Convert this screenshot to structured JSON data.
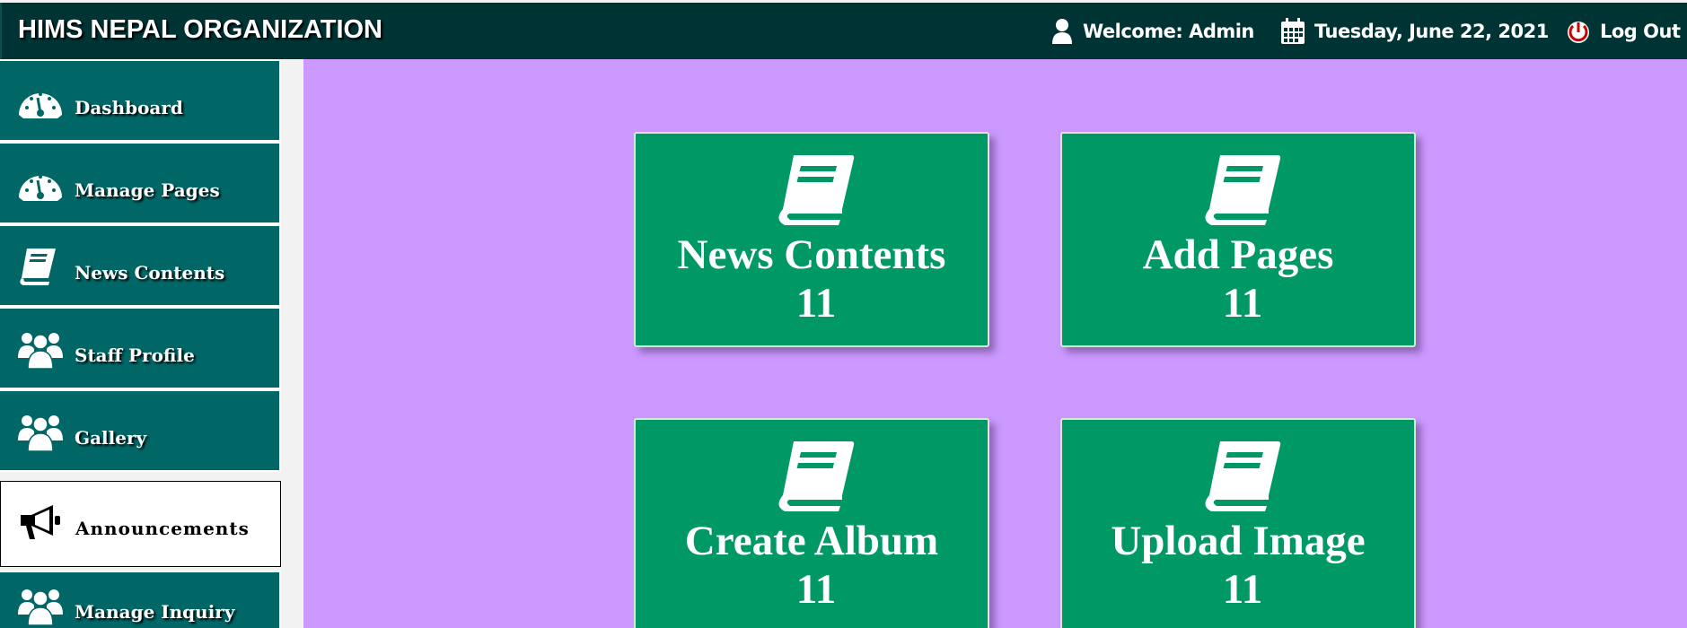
{
  "header": {
    "title": "HIMS NEPAL ORGANIZATION",
    "welcome": "Welcome: Admin",
    "date": "Tuesday, June 22, 2021",
    "logout": "Log Out"
  },
  "sidebar": {
    "items": [
      {
        "label": "Dashboard",
        "icon": "dashboard-icon"
      },
      {
        "label": "Manage Pages",
        "icon": "dashboard-icon"
      },
      {
        "label": "News Contents",
        "icon": "book-icon"
      },
      {
        "label": "Staff Profile",
        "icon": "users-icon"
      },
      {
        "label": "Gallery",
        "icon": "users-icon"
      },
      {
        "label": "Announcements",
        "icon": "megaphone-icon",
        "active": true
      },
      {
        "label": "Manage Inquiry",
        "icon": "users-icon"
      }
    ]
  },
  "cards": [
    {
      "title": "News Contents",
      "count": "11",
      "icon": "book-icon"
    },
    {
      "title": "Add Pages",
      "count": "11",
      "icon": "book-icon"
    },
    {
      "title": "Create Album",
      "count": "11",
      "icon": "book-icon"
    },
    {
      "title": "Upload Image",
      "count": "11",
      "icon": "book-icon"
    }
  ],
  "colors": {
    "header_bg": "#003333",
    "sidebar_bg": "#006666",
    "content_bg": "#cc99ff",
    "card_bg": "#009966",
    "logout_icon": "#cc0000"
  }
}
